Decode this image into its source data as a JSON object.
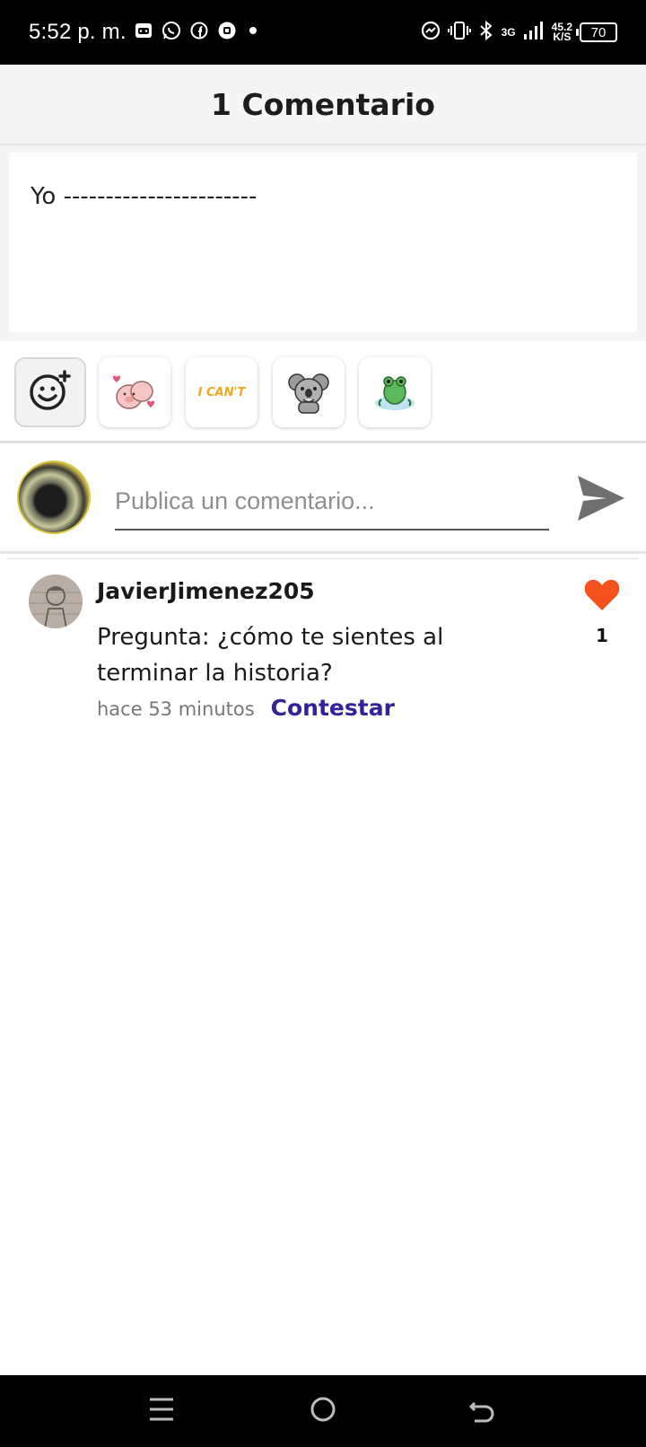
{
  "status_bar": {
    "time": "5:52 p. m.",
    "left_icons": [
      "gamepad-icon",
      "whatsapp-icon",
      "facebook-icon",
      "messenger-icon",
      "dot-icon"
    ],
    "right_icons": [
      "messenger-circle-icon",
      "vibrate-icon",
      "bluetooth-icon",
      "signal-icon"
    ],
    "network_type": "3G",
    "net_speed": "45.2",
    "net_speed_unit": "K/S",
    "battery": "70"
  },
  "header": {
    "title": "1 Comentario"
  },
  "compose": {
    "text": "Yo -----------------------"
  },
  "stickers": [
    {
      "name": "add-sticker-icon"
    },
    {
      "name": "pig-love-sticker"
    },
    {
      "name": "i-cant-sticker",
      "text": "I CAN'T"
    },
    {
      "name": "koala-sticker"
    },
    {
      "name": "frog-sticker"
    }
  ],
  "comment_input": {
    "placeholder": "Publica un comentario..."
  },
  "comments": [
    {
      "username": "JavierJimenez205",
      "text": "Pregunta: ¿cómo te sientes al terminar la historia?",
      "time": "hace 53 minutos",
      "reply_label": "Contestar",
      "likes": "1"
    }
  ],
  "colors": {
    "accent_reply": "#35229a",
    "like_heart": "#f4511e",
    "header_bg": "#f5f5f5"
  },
  "nav_bar": {
    "buttons": [
      "menu-icon",
      "home-icon",
      "back-icon"
    ]
  }
}
